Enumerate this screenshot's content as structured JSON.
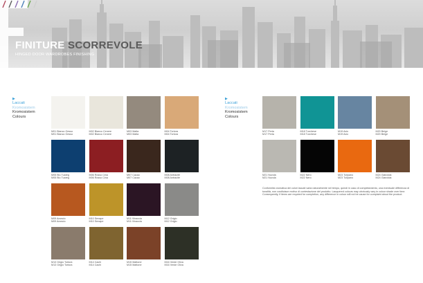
{
  "header": {
    "title_part1": "FINITURE",
    "title_part2": "SCORREVOLE",
    "subtitle": "HINGED DOOR WARDROBES FINISHING",
    "stripe_colors": [
      "#b0485c",
      "#5a5a5a",
      "#8a6bb0",
      "#4c7fb8",
      "#6aa84f",
      "#d0d0d0"
    ]
  },
  "left_section": {
    "arrow": "▶",
    "lines": [
      "Laccati",
      "Kromosistem",
      "Kromosistem",
      "Colours"
    ],
    "swatches": [
      {
        "color": "#f4f3ef",
        "caption1": "M01 Bianco Gesso",
        "caption2": "M01 Bianco Gesso"
      },
      {
        "color": "#e9e6dc",
        "caption1": "M02 Bianco Cenere",
        "caption2": "M02 Bianco Cenere"
      },
      {
        "color": "#948a7e",
        "caption1": "M03 Malta",
        "caption2": "M03 Malta"
      },
      {
        "color": "#d9a978",
        "caption1": "M04 Tortora",
        "caption2": "M04 Tortora"
      },
      {
        "color": "#0d3f70",
        "caption1": "M05 Blu Tuareg",
        "caption2": "M05 Blu Tuareg"
      },
      {
        "color": "#8c1e22",
        "caption1": "M06 Rosso Cina",
        "caption2": "M06 Rosso Cina"
      },
      {
        "color": "#3a271d",
        "caption1": "M07 Cacao",
        "caption2": "M07 Cacao"
      },
      {
        "color": "#1d2224",
        "caption1": "M08 Antracite",
        "caption2": "M08 Antracite"
      },
      {
        "color": "#b7581f",
        "caption1": "M09 Arancio",
        "caption2": "M09 Arancio"
      },
      {
        "color": "#bd9429",
        "caption1": "M10 Senape",
        "caption2": "M10 Senape"
      },
      {
        "color": "#2b1524",
        "caption1": "M11 Vinaccia",
        "caption2": "M11 Vinaccia"
      },
      {
        "color": "#8a8a88",
        "caption1": "M12 Grigio",
        "caption2": "M12 Grigio"
      },
      {
        "color": "#8a7b6c",
        "caption1": "M13 Grigio Tortora",
        "caption2": "M13 Grigio Tortora"
      },
      {
        "color": "#7f6430",
        "caption1": "M14 Cachi",
        "caption2": "M14 Cachi"
      },
      {
        "color": "#7b4228",
        "caption1": "M15 Mattone",
        "caption2": "M15 Mattone"
      },
      {
        "color": "#2d3026",
        "caption1": "M16 Verde Oliva",
        "caption2": "M16 Verde Oliva"
      }
    ]
  },
  "right_section": {
    "arrow": "▶",
    "lines": [
      "Laccati",
      "Kromosistem",
      "Kromosistem",
      "Colours"
    ],
    "swatches": [
      {
        "color": "#b6b3ab",
        "caption1": "M17 Perla",
        "caption2": "M17 Perla"
      },
      {
        "color": "#109495",
        "caption1": "M18 Turchese",
        "caption2": "M18 Turchese"
      },
      {
        "color": "#6785a1",
        "caption1": "M19 Avio",
        "caption2": "M19 Avio"
      },
      {
        "color": "#a49078",
        "caption1": "M20 Beige",
        "caption2": "M20 Beige"
      },
      {
        "color": "#bab8b2",
        "caption1": "M21 Nuvola",
        "caption2": "M21 Nuvola"
      },
      {
        "color": "#050505",
        "caption1": "M22 Nero",
        "caption2": "M22 Nero"
      },
      {
        "color": "#e96910",
        "caption1": "M23 Tulipano",
        "caption2": "M23 Tulipano"
      },
      {
        "color": "#6a4a33",
        "caption1": "M24 Giandola",
        "caption2": "M24 Giandola"
      }
    ],
    "note": "Conformità cromatica dei colori laccati varia naturalmente nel tempo, quindi in caso di completamento, una eventuale differenza di tonalità, non costituisce motivo di contestazione del prodotto. Lacquered colours may obviously vary in colour shade over time. Consequently, if items are required for completion, any difference in colour will not be cause for complaint about the product."
  }
}
